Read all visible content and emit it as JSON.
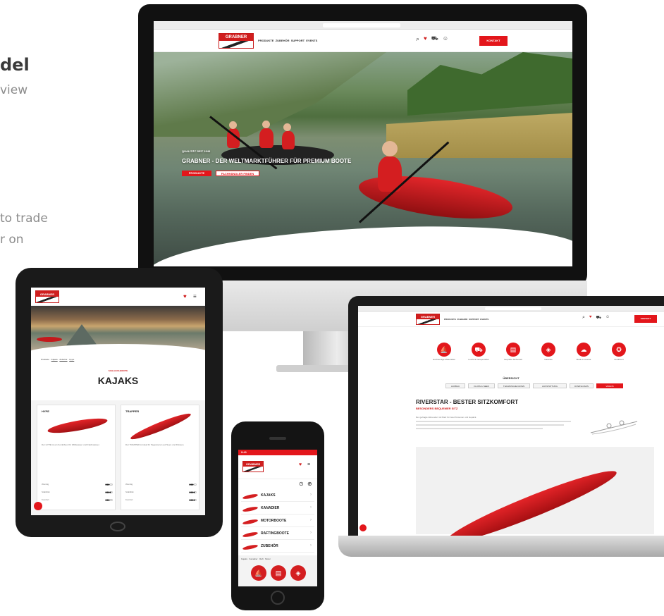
{
  "background_text": {
    "title": "del",
    "subtitle": "view",
    "line1": "to trade",
    "line2": "r on"
  },
  "imac": {
    "nav": [
      "PRODUKTE",
      "ZUBEHÖR",
      "SUPPORT",
      "EVENTS"
    ],
    "header_icons": [
      "search-icon",
      "wishlist-icon",
      "cart-icon",
      "user-icon"
    ],
    "header_button": "KONTAKT",
    "hero": {
      "kicker": "QUALITÄT SEIT 1949",
      "headline": "GRABNER - DER WELTMARKTFÜHRER FÜR PREMIUM BOOTE",
      "btn_primary": "PRODUKTE",
      "btn_secondary": "FACHHÄNDLER FINDEN"
    },
    "brand": "GRABNER"
  },
  "ipad": {
    "breadcrumb": [
      "Produkte",
      "Kajaks",
      "Zubehör",
      "Hype"
    ],
    "kicker": "SCHLAUCHBOOTE",
    "page_title": "KAJAKS",
    "cards": [
      {
        "name": "HYPE",
        "text": "Der HYPE ist ein Kombiboot für Wildwasser und Flachwasser.",
        "ratings": [
          {
            "label": "Wendig",
            "value": 3
          },
          {
            "label": "Stabilität",
            "value": 4
          },
          {
            "label": "Komfort",
            "value": 3
          }
        ]
      },
      {
        "name": "TRAPPER",
        "text": "Der TRAPPER ist ideal für Tagestouren auf Seen und Flüssen.",
        "ratings": [
          {
            "label": "Wendig",
            "value": 3
          },
          {
            "label": "Stabilität",
            "value": 4
          },
          {
            "label": "Komfort",
            "value": 4
          }
        ]
      }
    ]
  },
  "laptop": {
    "nav": [
      "PRODUKTE",
      "ZUBEHÖR",
      "SUPPORT",
      "EVENTS"
    ],
    "header_button": "KONTAKT",
    "features": [
      {
        "icon": "boat-icon",
        "label": "Hochwertige Materialien"
      },
      {
        "icon": "transport-icon",
        "label": "Leicht & transportabel"
      },
      {
        "icon": "document-icon",
        "label": "Geprüfte Sicherheit"
      },
      {
        "icon": "shield-icon",
        "label": "Garantie"
      },
      {
        "icon": "cloud-icon",
        "label": "Made in Austria"
      },
      {
        "icon": "certificate-icon",
        "label": "Zertifiziert"
      }
    ],
    "tabs_heading": "ÜBERSICHT",
    "tabs": [
      "AUFBAU",
      "FLUSS & SEEN",
      "TECHNISCHE DATEN",
      "AUSSTATTUNG",
      "DOWNLOADS",
      "VIDEOS"
    ],
    "product_title": "RIVERSTAR - BESTER SITZKOMFORT",
    "product_subtitle": "BESONDERS BEQUEMER SITZ",
    "description": "Der gefragte Allrounder mit Platz für zwei Personen und Gepäck."
  },
  "iphone": {
    "status_time": "9:41",
    "menu": [
      "KAJAKS",
      "KANADIER",
      "MOTORBOOTE",
      "RAFTINGBOOTE",
      "ZUBEHÖR"
    ],
    "tabs": [
      "Kajaks",
      "Kanadier",
      "Raft",
      "Motor"
    ],
    "icons": [
      "boat-icon",
      "document-icon",
      "shield-icon"
    ]
  },
  "colors": {
    "brand_red": "#e3161b",
    "dark": "#1b1b1b"
  }
}
